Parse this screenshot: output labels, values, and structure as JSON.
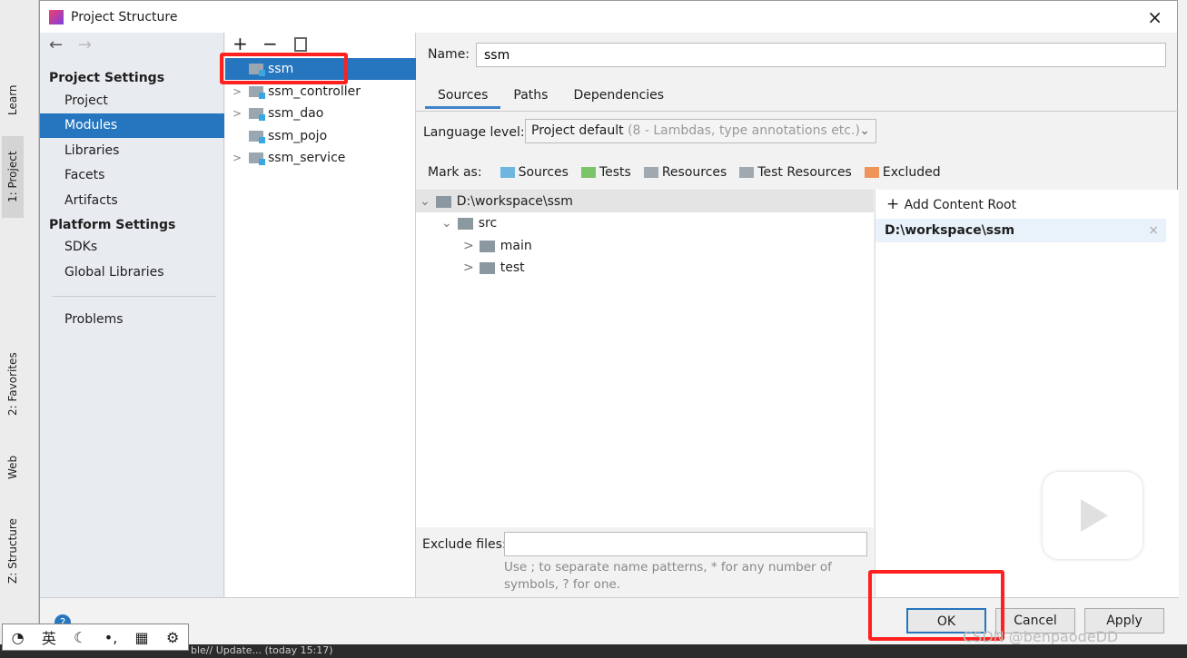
{
  "dialog": {
    "title": "Project Structure",
    "close": "×"
  },
  "ide": {
    "tool_tabs": [
      "Learn",
      "1: Project",
      "2: Favorites",
      "Web",
      "Z: Structure"
    ],
    "status_text": "ble// Update... (today 15:17)",
    "ime": [
      "英"
    ],
    "watermark": "CSDN @benpaodeDD"
  },
  "nav": {
    "back": "←",
    "forward": "→",
    "project_settings": "Project Settings",
    "items": [
      {
        "label": "Project"
      },
      {
        "label": "Modules",
        "selected": true
      },
      {
        "label": "Libraries"
      },
      {
        "label": "Facets"
      },
      {
        "label": "Artifacts"
      }
    ],
    "platform_settings": "Platform Settings",
    "platform_items": [
      {
        "label": "SDKs"
      },
      {
        "label": "Global Libraries"
      }
    ],
    "problems": "Problems"
  },
  "modules": {
    "toolbar": [
      "+",
      "−"
    ],
    "items": [
      {
        "label": "ssm",
        "selected": true,
        "expandable": false
      },
      {
        "label": "ssm_controller",
        "expandable": true
      },
      {
        "label": "ssm_dao",
        "expandable": true
      },
      {
        "label": "ssm_pojo",
        "expandable": false
      },
      {
        "label": "ssm_service",
        "expandable": true
      }
    ]
  },
  "main": {
    "name_label": "Name:",
    "name_value": "ssm",
    "tabs": [
      "Sources",
      "Paths",
      "Dependencies"
    ],
    "active_tab": "Sources",
    "language_label": "Language level:",
    "language_value": "Project default",
    "language_hint": "(8 - Lambdas, type annotations etc.)",
    "mark_as_label": "Mark as:",
    "mark_as": [
      {
        "label": "Sources",
        "color": "#6eb5e0"
      },
      {
        "label": "Tests",
        "color": "#7cc46a"
      },
      {
        "label": "Resources",
        "color": "#a0a8b0"
      },
      {
        "label": "Test Resources",
        "color": "#a0a8b0"
      },
      {
        "label": "Excluded",
        "color": "#f0955a"
      }
    ],
    "tree": [
      {
        "label": "D:\\workspace\\ssm",
        "depth": 0,
        "expanded": true
      },
      {
        "label": "src",
        "depth": 1,
        "expanded": true
      },
      {
        "label": "main",
        "depth": 2,
        "expanded": false
      },
      {
        "label": "test",
        "depth": 2,
        "expanded": false
      }
    ],
    "add_content_root": "Add Content Root",
    "content_root": "D:\\workspace\\ssm",
    "exclude_label": "Exclude files:",
    "exclude_value": "",
    "exclude_hint_1": "Use ; to separate name patterns, * for any number of",
    "exclude_hint_2": "symbols, ? for one."
  },
  "buttons": {
    "help": "?",
    "ok": "OK",
    "cancel": "Cancel",
    "apply": "Apply"
  },
  "colors": {
    "selection": "#2675bf",
    "highlight": "#ff2020"
  }
}
